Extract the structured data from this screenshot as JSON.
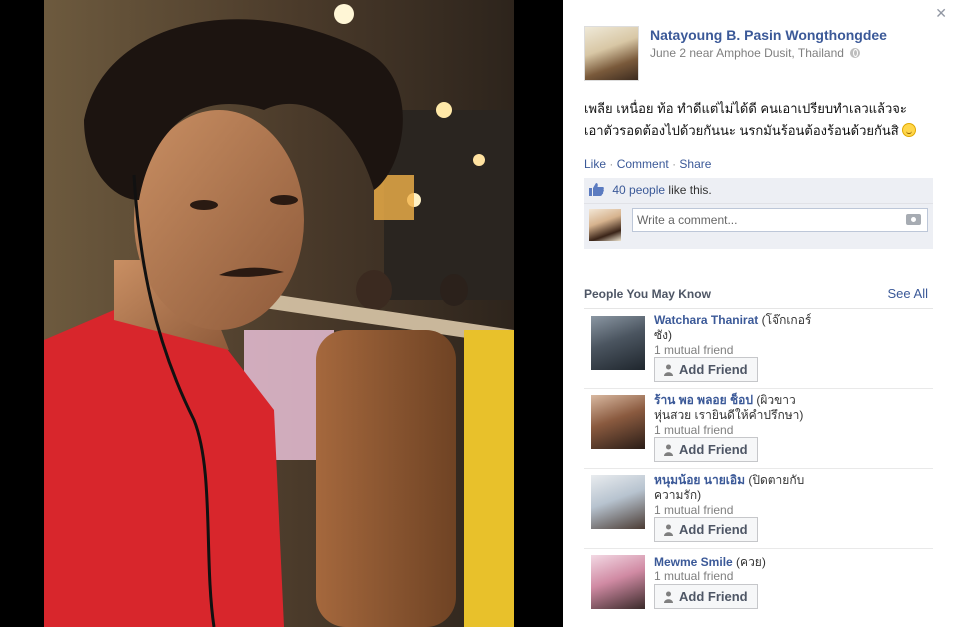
{
  "post": {
    "author": "Natayoung B. Pasin Wongthongdee",
    "date": "June 2",
    "location": "near Amphoe Dusit, Thailand",
    "text_line1": "เพลีย เหนื่อย ท้อ ทำดีแต่ไม่ได้ดี คนเอาเปรียบทำเลวแล้วจะ",
    "text_line2": "เอาตัวรอดต้องไปด้วยกันนะ นรกมันร้อนต้องร้อนด้วยกันสิ"
  },
  "actions": {
    "like": "Like",
    "comment": "Comment",
    "share": "Share",
    "separator": "·"
  },
  "ufi": {
    "likes_count": "40 people",
    "likes_suffix": "like this.",
    "comment_placeholder": "Write a comment..."
  },
  "pymk": {
    "title": "People You May Know",
    "see_all": "See All",
    "add_friend_label": "Add Friend",
    "people": [
      {
        "name": "Watchara Thanirat",
        "extra_line1": "(โจ๊กเกอร์",
        "extra_line2": "ซัง)",
        "mutual": "1 mutual friend"
      },
      {
        "name": "ร้าน พอ พลอย ช็อป",
        "extra_line1": "(ผิวขาว",
        "extra_line2": "หุ่นสวย เรายินดีให้คำปรึกษา)",
        "mutual": "1 mutual friend"
      },
      {
        "name": "หนุมน้อย นายเอิม",
        "extra_line1": "(ปิดตายกับ",
        "extra_line2": "ความรัก)",
        "mutual": "1 mutual friend"
      },
      {
        "name": "Mewme Smile",
        "extra_line1": "(ควย)",
        "extra_line2": "",
        "mutual": "1 mutual friend"
      }
    ]
  },
  "icons": {
    "close": "close-icon",
    "globe": "globe-icon",
    "like_thumb": "thumbs-up-icon",
    "camera": "camera-icon",
    "smile": "smile-emoji-icon",
    "add_friend": "add-friend-icon"
  },
  "colors": {
    "link_blue": "#3b5998",
    "ufi_bg": "#edeff4",
    "meta_gray": "#7f7f7f",
    "photo_shirt_red": "#d8262c",
    "booth_yellow": "#e8c12b"
  }
}
